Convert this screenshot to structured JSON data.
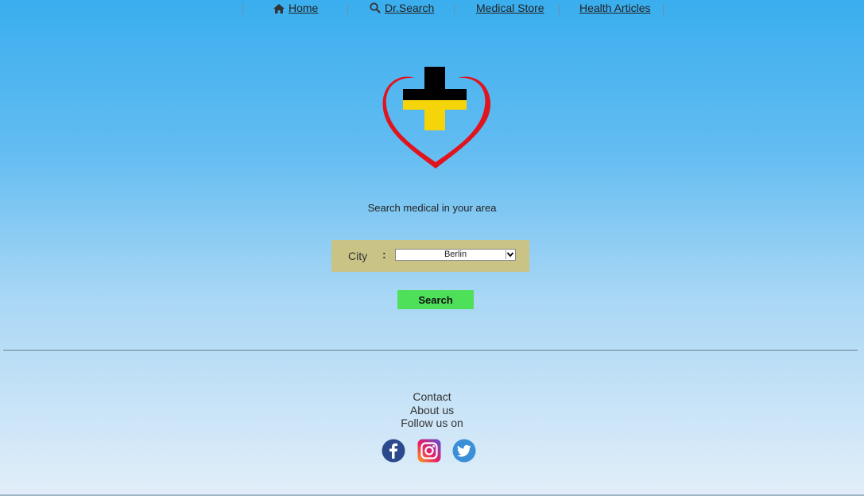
{
  "nav": {
    "home": "Home",
    "drsearch": "Dr.Search",
    "medical_store": "Medical Store",
    "health_articles": "Health Articles"
  },
  "tagline": "Search medical in your area",
  "search_form": {
    "city_label": "City",
    "colon": ":",
    "city_value": "Berlin",
    "button_label": "Search"
  },
  "footer": {
    "contact": "Contact",
    "about": "About us",
    "follow": "Follow us on"
  },
  "social": [
    "facebook-icon",
    "instagram-icon",
    "twitter-icon"
  ],
  "colors": {
    "background_top": "#3aaeee",
    "background_bottom": "#e2eef9",
    "form_panel": "#c9c386",
    "search_button": "#4fe05a",
    "logo_heart": "#e0141e",
    "logo_cross_top": "#000000",
    "logo_cross_bottom": "#f5d40a"
  }
}
